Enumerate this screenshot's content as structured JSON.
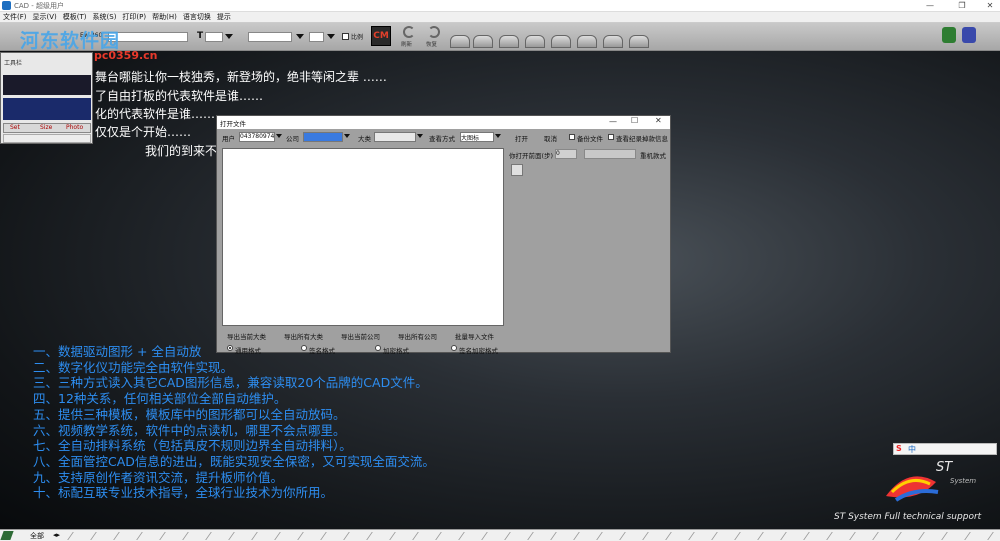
{
  "window": {
    "title": "CAD - 超级用户"
  },
  "menu": [
    "文件(F)",
    "显示(V)",
    "模板(T)",
    "系统(S)",
    "打印(P)",
    "帮助(H)",
    "语言切换",
    "提示"
  ],
  "toolbar": {
    "zoom_label": "Ew-360",
    "text_tool": "T",
    "ratio_label": "比例",
    "cm_logo": "CM",
    "refresh_label": "刷新",
    "recover_label": "恢复"
  },
  "watermark": {
    "name": "河东软件园",
    "url": "www.pc0359.cn"
  },
  "toolbox": {
    "title": "工具栏",
    "tabs": [
      "Set",
      "Size",
      "Photo"
    ]
  },
  "intro_lines": [
    "舞台哪能让你一枝独秀，新登场的，绝非等闲之辈 ……",
    "了自由打板的代表软件是谁……",
    "化的代表软件是谁……",
    "仅仅是个开始……",
    "我们的到来不"
  ],
  "dialog": {
    "title": "打开文件",
    "user_label": "用户",
    "user_value": "043780974",
    "company_label": "公司",
    "category_label": "大类",
    "view_label": "查看方式",
    "view_value": "大图标",
    "open_button": "打开",
    "cancel_button": "取消",
    "backup_label": "备份文件",
    "record_label": "查看纪录掉款信息",
    "open_count_label": "你打开前面(步)",
    "open_count_value": "0",
    "rename_button": "重机款式",
    "bottom_links": [
      "导出当前大类",
      "导出所有大类",
      "导出当前公司",
      "导出所有公司",
      "批量导入文件"
    ],
    "format_options": [
      "通用格式",
      "签名格式",
      "加密格式",
      "签名加密格式"
    ],
    "format_selected": 0
  },
  "features": [
    "一、数据驱动图形 + 全自动放",
    "二、数字化仪功能完全由软件实现。",
    "三、三种方式读入其它CAD图形信息，兼容读取20个品牌的CAD文件。",
    "四、12种关系，任何相关部位全部自动维护。",
    "五、提供三种模板，模板库中的图形都可以全自动放码。",
    "六、视频教学系统，软件中的点读机，哪里不会点哪里。",
    "七、全自动排料系统（包括真皮不规则边界全自动排料）。",
    "八、全面管控CAD信息的进出，既能实现安全保密，又可实现全面交流。",
    "九、支持原创作者资讯交流，提升板师价值。",
    "十、标配互联专业技术指导，全球行业技术为你所用。"
  ],
  "brand": {
    "logo_text": "ST",
    "logo_sub": "System",
    "tagline": "ST System Full technical support",
    "ime_label": "中"
  },
  "status": {
    "layer_label": "全部"
  }
}
